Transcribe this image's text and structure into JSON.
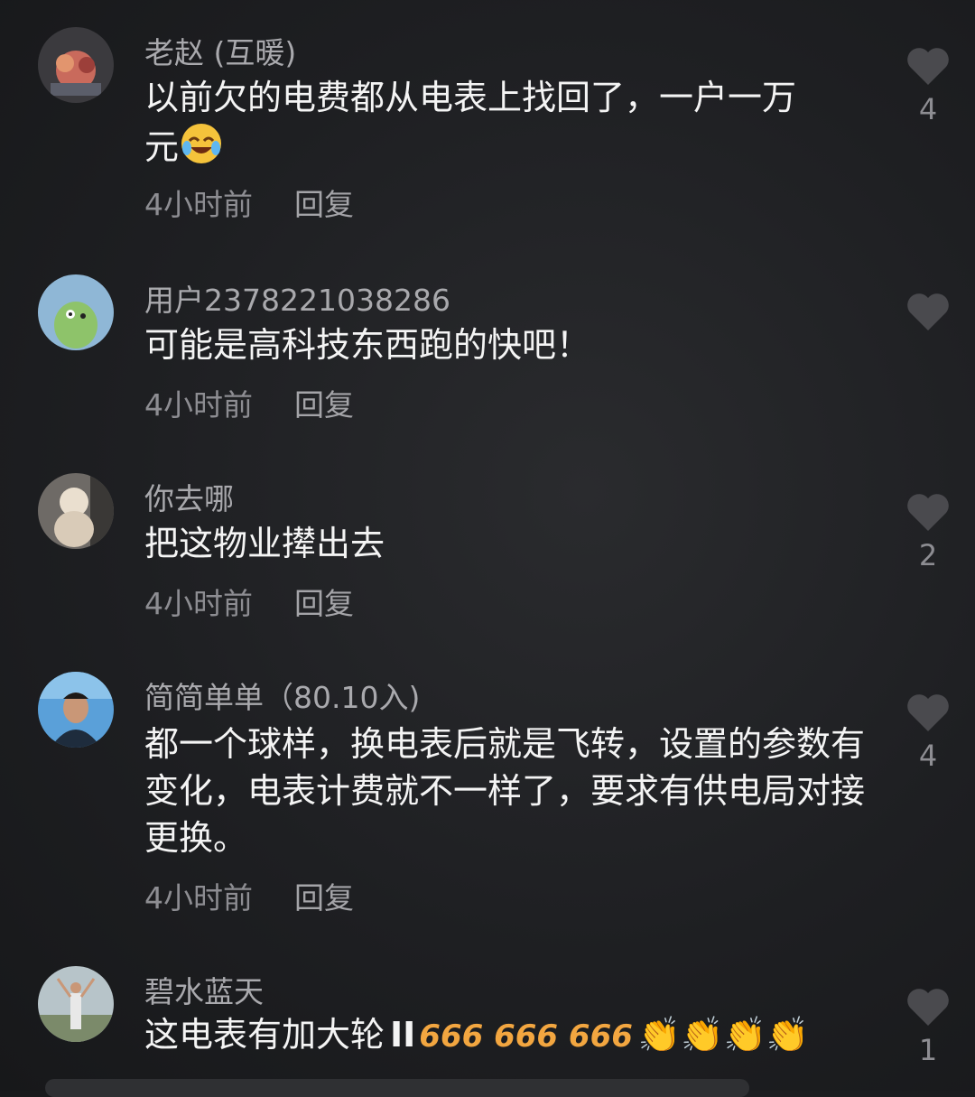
{
  "comments": [
    {
      "name": "老赵 (互暖)",
      "text": "以前欠的电费都从电表上找回了，一户一万\n元",
      "time": "4小时前",
      "reply": "回复",
      "likes": "4",
      "emoji": "laughing-crying"
    },
    {
      "name": "用户2378221038286",
      "text": "可能是高科技东西跑的快吧！",
      "time": "4小时前",
      "reply": "回复",
      "likes": ""
    },
    {
      "name": "你去哪",
      "text": "把这物业撵出去",
      "time": "4小时前",
      "reply": "回复",
      "likes": "2"
    },
    {
      "name": "简简单单（80.10入)",
      "text": "都一个球样，换电表后就是飞转，设置的参数有变化，电表计费就不一样了，要求有供电局对接更换。",
      "time": "4小时前",
      "reply": "回复",
      "likes": "4"
    },
    {
      "name": "碧水蓝天",
      "text": "这电表有加大轮",
      "time": "",
      "reply": "",
      "likes": "1",
      "emoji_tail": "666 666 666 clapping x4"
    }
  ],
  "colors": {
    "background": "#1e1f22",
    "text": "#f4f4f4",
    "muted": "#8d8d92",
    "heart": "#4a4a4e"
  }
}
